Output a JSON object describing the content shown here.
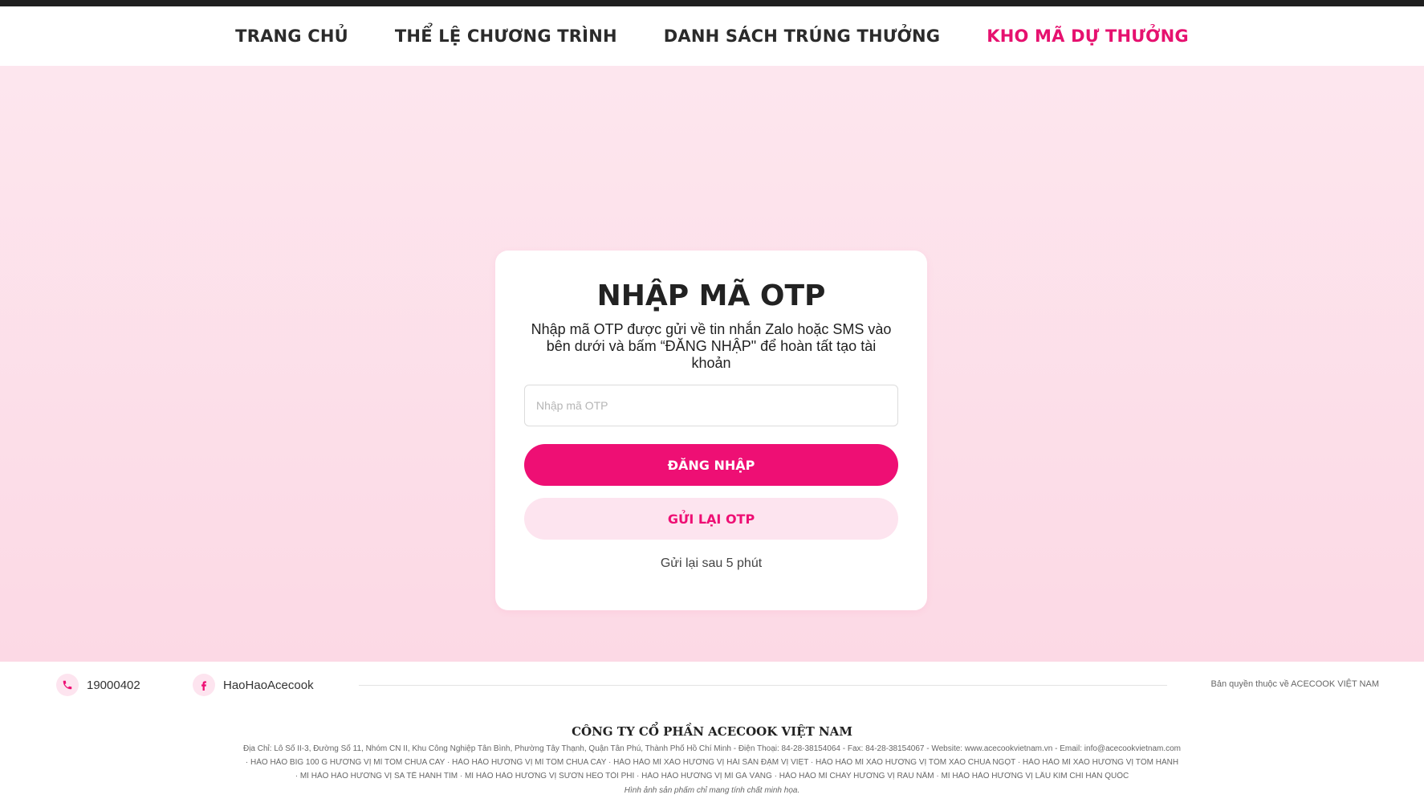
{
  "nav": {
    "items": [
      {
        "label": "TRANG CHỦ",
        "active": false
      },
      {
        "label": "THỂ LỆ CHƯƠNG TRÌNH",
        "active": false
      },
      {
        "label": "DANH SÁCH TRÚNG THƯỞNG",
        "active": false
      },
      {
        "label": "KHO MÃ DỰ THƯỞNG",
        "active": true
      }
    ]
  },
  "otp": {
    "title": "NHẬP MÃ OTP",
    "description": "Nhập mã OTP được gửi về tin nhắn Zalo hoặc SMS vào bên dưới và bấm “ĐĂNG NHẬP\" để hoàn tất tạo tài khoản",
    "input_value": "",
    "input_placeholder": "Nhập mã OTP",
    "login_label": "ĐĂNG NHẬP",
    "resend_label": "GỬI LẠI OTP",
    "resend_note": "Gửi lại sau 5 phút"
  },
  "footer": {
    "phone": "19000402",
    "facebook": "HaoHaoAcecook",
    "copyright": "Bản quyền thuộc về ACECOOK VIỆT NAM",
    "company": "CÔNG TY CỔ PHẦN ACECOOK VIỆT NAM",
    "address_line": "Địa Chỉ: Lô Số II-3, Đường Số 11, Nhóm CN II, Khu Công Nghiệp Tân Bình, Phường Tây Thạnh, Quận Tân Phú, Thành Phố Hồ Chí Minh - Điện Thoại: 84-28-38154064 - Fax: 84-28-38154067 - Website: www.acecookvietnam.vn - Email: info@acecookvietnam.com",
    "products_line_1": "· HẢO HẢO BIG 100 G HƯƠNG VỊ MÌ TÔM CHUA CAY · HẢO HẢO HƯƠNG VỊ MÌ TÔM CHUA CAY · HẢO HẢO MÌ XÀO HƯƠNG VỊ HẢI SẢN ĐẬM VỊ VIỆT · HẢO HẢO MÌ XÀO HƯƠNG VỊ TÔM XÀO CHUA NGỌT · HẢO HẢO MÌ XÀO HƯƠNG VỊ TÔM HÀNH",
    "products_line_2": "· MÌ HẢO HẢO HƯƠNG VỊ SA TẾ HÀNH TÍM · MÌ HẢO HẢO HƯƠNG VỊ SƯỜN HEO TỎI PHI · HẢO HẢO HƯƠNG VỊ MÌ GÀ VÀNG · HẢO HẢO MÌ CHAY HƯƠNG VỊ RAU NẤM · MÌ HẢO HẢO HƯƠNG VỊ LẨU KIM CHI HÀN QUỐC",
    "disclaimer": "Hình ảnh sản phẩm chỉ mang tính chất minh họa."
  },
  "colors": {
    "brand": "#ee0f74",
    "brand_light": "#fde4ef",
    "background": "#fde3ec"
  },
  "icons": {
    "phone": "phone-icon",
    "facebook": "facebook-icon"
  }
}
